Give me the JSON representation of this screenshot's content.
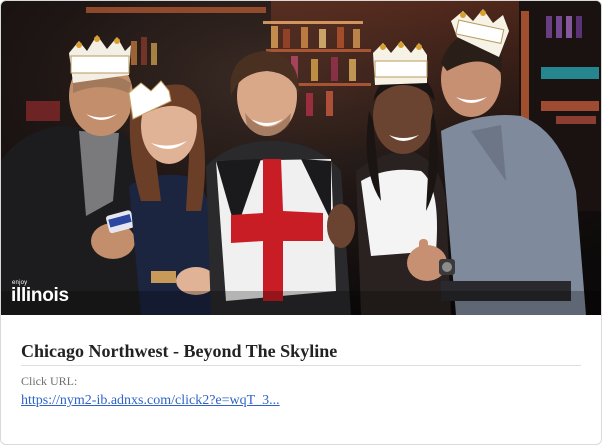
{
  "ad": {
    "image_alt": "Five friends wearing paper crowns laughing in a bar",
    "brand": {
      "small": "enjoy",
      "big": "illinois"
    },
    "headline": "Chicago Northwest - Beyond The Skyline",
    "click_label": "Click URL:",
    "click_url_text": "https://nym2-ib.adnxs.com/click2?e=wqT_3...",
    "link_color": "#2f63c9"
  }
}
